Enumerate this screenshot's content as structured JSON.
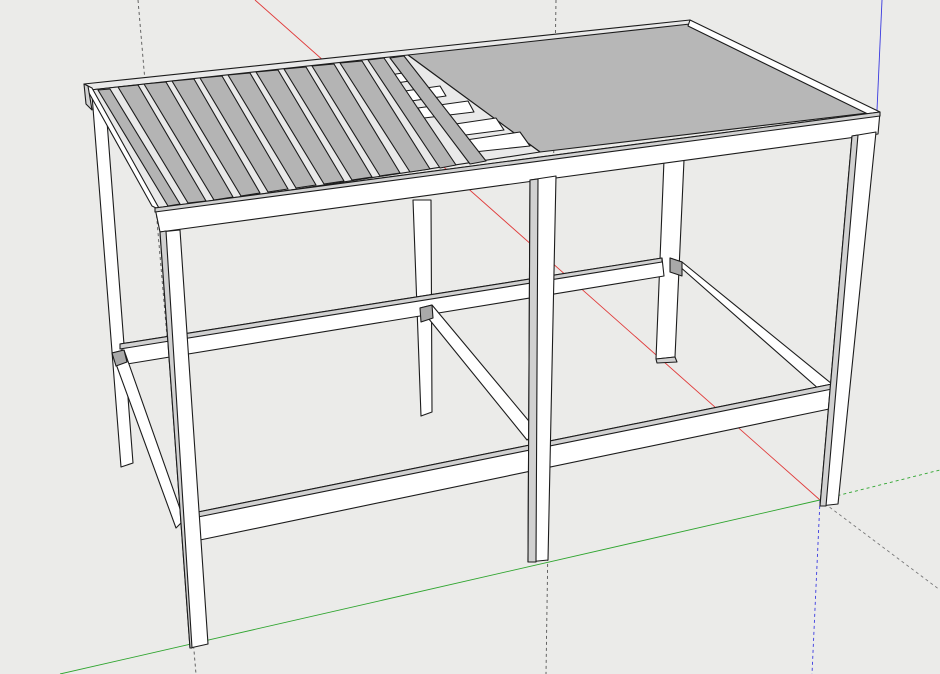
{
  "canvas": {
    "background": "#ebebe9",
    "axis_colors": {
      "x": "#e03a3a",
      "y": "#2fa52f",
      "z": "#3a3ae0",
      "guide": "#555555"
    }
  },
  "model": {
    "shading": {
      "white": "#ffffff",
      "light": "#e9e9e9",
      "mid": "#d1d1d1",
      "dark": "#a9a9a9",
      "slat": "#b4b4b4",
      "plate": "#b7b7b7"
    }
  }
}
